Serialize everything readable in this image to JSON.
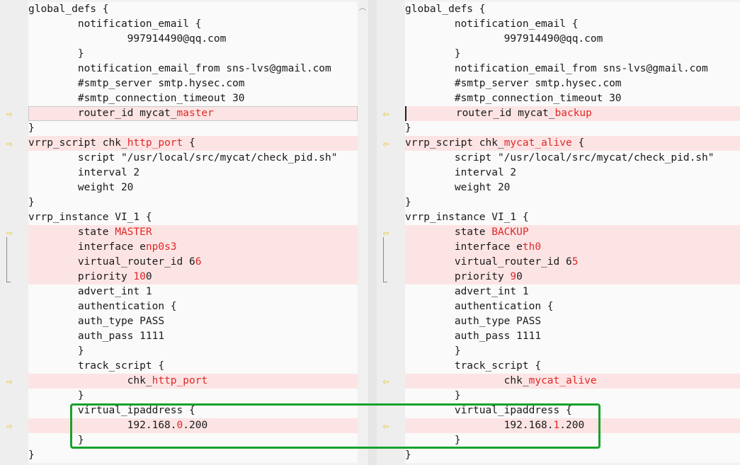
{
  "left": {
    "lines": [
      {
        "p": "global_defs {"
      },
      {
        "p": "        notification_email {"
      },
      {
        "p": "                997914490@qq.com"
      },
      {
        "p": "        }"
      },
      {
        "p": "        notification_email_from sns-lvs@gmail.com"
      },
      {
        "p": "        #smtp_server smtp.hysec.com"
      },
      {
        "p": "        #smtp_connection_timeout 30"
      },
      {
        "p": "        router_id mycat_",
        "h": "master",
        "diff": true,
        "arrow": true,
        "cur": true
      },
      {
        "p": "}"
      },
      {
        "p": "vrrp_script chk_",
        "h": "http_port",
        "s": " {",
        "diff": true,
        "arrow": true
      },
      {
        "p": "        script \"/usr/local/src/mycat/check_pid.sh\""
      },
      {
        "p": "        interval 2"
      },
      {
        "p": "        weight 20"
      },
      {
        "p": "}"
      },
      {
        "p": "vrrp_instance VI_1 {"
      },
      {
        "p": "        state ",
        "h": "MASTER",
        "diff": true,
        "arrow": true
      },
      {
        "p": "        interface e",
        "h": "np0s3",
        "diff": true
      },
      {
        "p": "        virtual_router_id 6",
        "h": "6",
        "diff": true
      },
      {
        "p": "        priority ",
        "h": "10",
        "s": "0",
        "diff": true
      },
      {
        "p": "        advert_int 1"
      },
      {
        "p": "        authentication {"
      },
      {
        "p": "        auth_type PASS"
      },
      {
        "p": "        auth_pass 1111"
      },
      {
        "p": "        }"
      },
      {
        "p": "        track_script {"
      },
      {
        "p": "                chk_",
        "h": "http_port",
        "diff": true,
        "arrow": true
      },
      {
        "p": "        }"
      },
      {
        "p": "        virtual_ipaddress {"
      },
      {
        "p": "                192.168.",
        "h": "0",
        "s": ".200",
        "diff": true,
        "arrow": true
      },
      {
        "p": "        }"
      },
      {
        "p": "}"
      }
    ]
  },
  "right": {
    "lines": [
      {
        "p": "global_defs {"
      },
      {
        "p": "        notification_email {"
      },
      {
        "p": "                997914490@qq.com"
      },
      {
        "p": "        }"
      },
      {
        "p": "        notification_email_from sns-lvs@gmail.com"
      },
      {
        "p": "        #smtp_server smtp.hysec.com"
      },
      {
        "p": "        #smtp_connection_timeout 30"
      },
      {
        "p": "        router_id mycat_",
        "h": "backup",
        "diff": true,
        "arrow": true,
        "caret": true
      },
      {
        "p": "}"
      },
      {
        "p": "vrrp_script chk_",
        "h": "mycat_alive",
        "s": " {",
        "diff": true,
        "arrow": true
      },
      {
        "p": "        script \"/usr/local/src/mycat/check_pid.sh\""
      },
      {
        "p": "        interval 2"
      },
      {
        "p": "        weight 20"
      },
      {
        "p": "}"
      },
      {
        "p": "vrrp_instance VI_1 {"
      },
      {
        "p": "        state ",
        "h": "BACKUP",
        "diff": true,
        "arrow": true
      },
      {
        "p": "        interface e",
        "h": "th0",
        "diff": true
      },
      {
        "p": "        virtual_router_id 6",
        "h": "5",
        "diff": true
      },
      {
        "p": "        priority ",
        "h": "9",
        "s": "0",
        "diff": true
      },
      {
        "p": "        advert_int 1"
      },
      {
        "p": "        authentication {"
      },
      {
        "p": "        auth_type PASS"
      },
      {
        "p": "        auth_pass 1111"
      },
      {
        "p": "        }"
      },
      {
        "p": "        track_script {"
      },
      {
        "p": "                chk_",
        "h": "mycat_alive",
        "diff": true,
        "arrow": true
      },
      {
        "p": "        }"
      },
      {
        "p": "        virtual_ipaddress {"
      },
      {
        "p": "                192.168.",
        "h": "1",
        "s": ".200",
        "diff": true,
        "arrow": true
      },
      {
        "p": "        }"
      },
      {
        "p": "}"
      }
    ]
  },
  "icons": {
    "left_arrow": "⇨",
    "right_arrow": "⇦",
    "scroll_up": "︿"
  },
  "colors": {
    "diff_bg": "#fde4e4",
    "diff_text": "#e02828",
    "arrow": "#e8c020",
    "highlight_box": "#17a22c"
  }
}
